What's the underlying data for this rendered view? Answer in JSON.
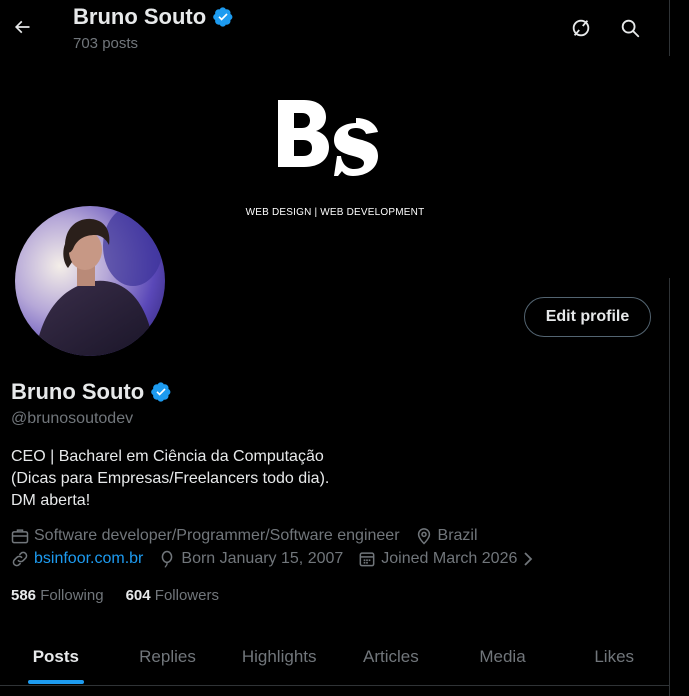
{
  "header": {
    "name": "Bruno Souto",
    "posts_count": "703 posts",
    "icons": [
      "back-arrow-icon",
      "grok-icon",
      "search-icon"
    ]
  },
  "banner": {
    "logo_text": "Bs",
    "tagline": "WEB DESIGN | WEB DEVELOPMENT"
  },
  "profile": {
    "name": "Bruno Souto",
    "handle": "@brunosoutodev",
    "edit_button": "Edit profile",
    "bio": [
      "CEO | Bacharel em Ciência da Computação",
      "(Dicas para Empresas/Freelancers todo dia).",
      "DM aberta!"
    ],
    "profession": "Software developer/Programmer/Software engineer",
    "location": "Brazil",
    "website": "bsinfoor.com.br",
    "born": "Born January 15, 2007",
    "joined": "Joined March 2026"
  },
  "stats": {
    "following_count": "586",
    "following_label": "Following",
    "followers_count": "604",
    "followers_label": "Followers"
  },
  "tabs": [
    {
      "label": "Posts",
      "active": true
    },
    {
      "label": "Replies",
      "active": false
    },
    {
      "label": "Highlights",
      "active": false
    },
    {
      "label": "Articles",
      "active": false
    },
    {
      "label": "Media",
      "active": false
    },
    {
      "label": "Likes",
      "active": false
    }
  ],
  "colors": {
    "accent": "#1d9bf0",
    "text_primary": "#e7e9ea",
    "text_secondary": "#71767b",
    "background": "#000000",
    "verified": "#1d9bf0"
  }
}
